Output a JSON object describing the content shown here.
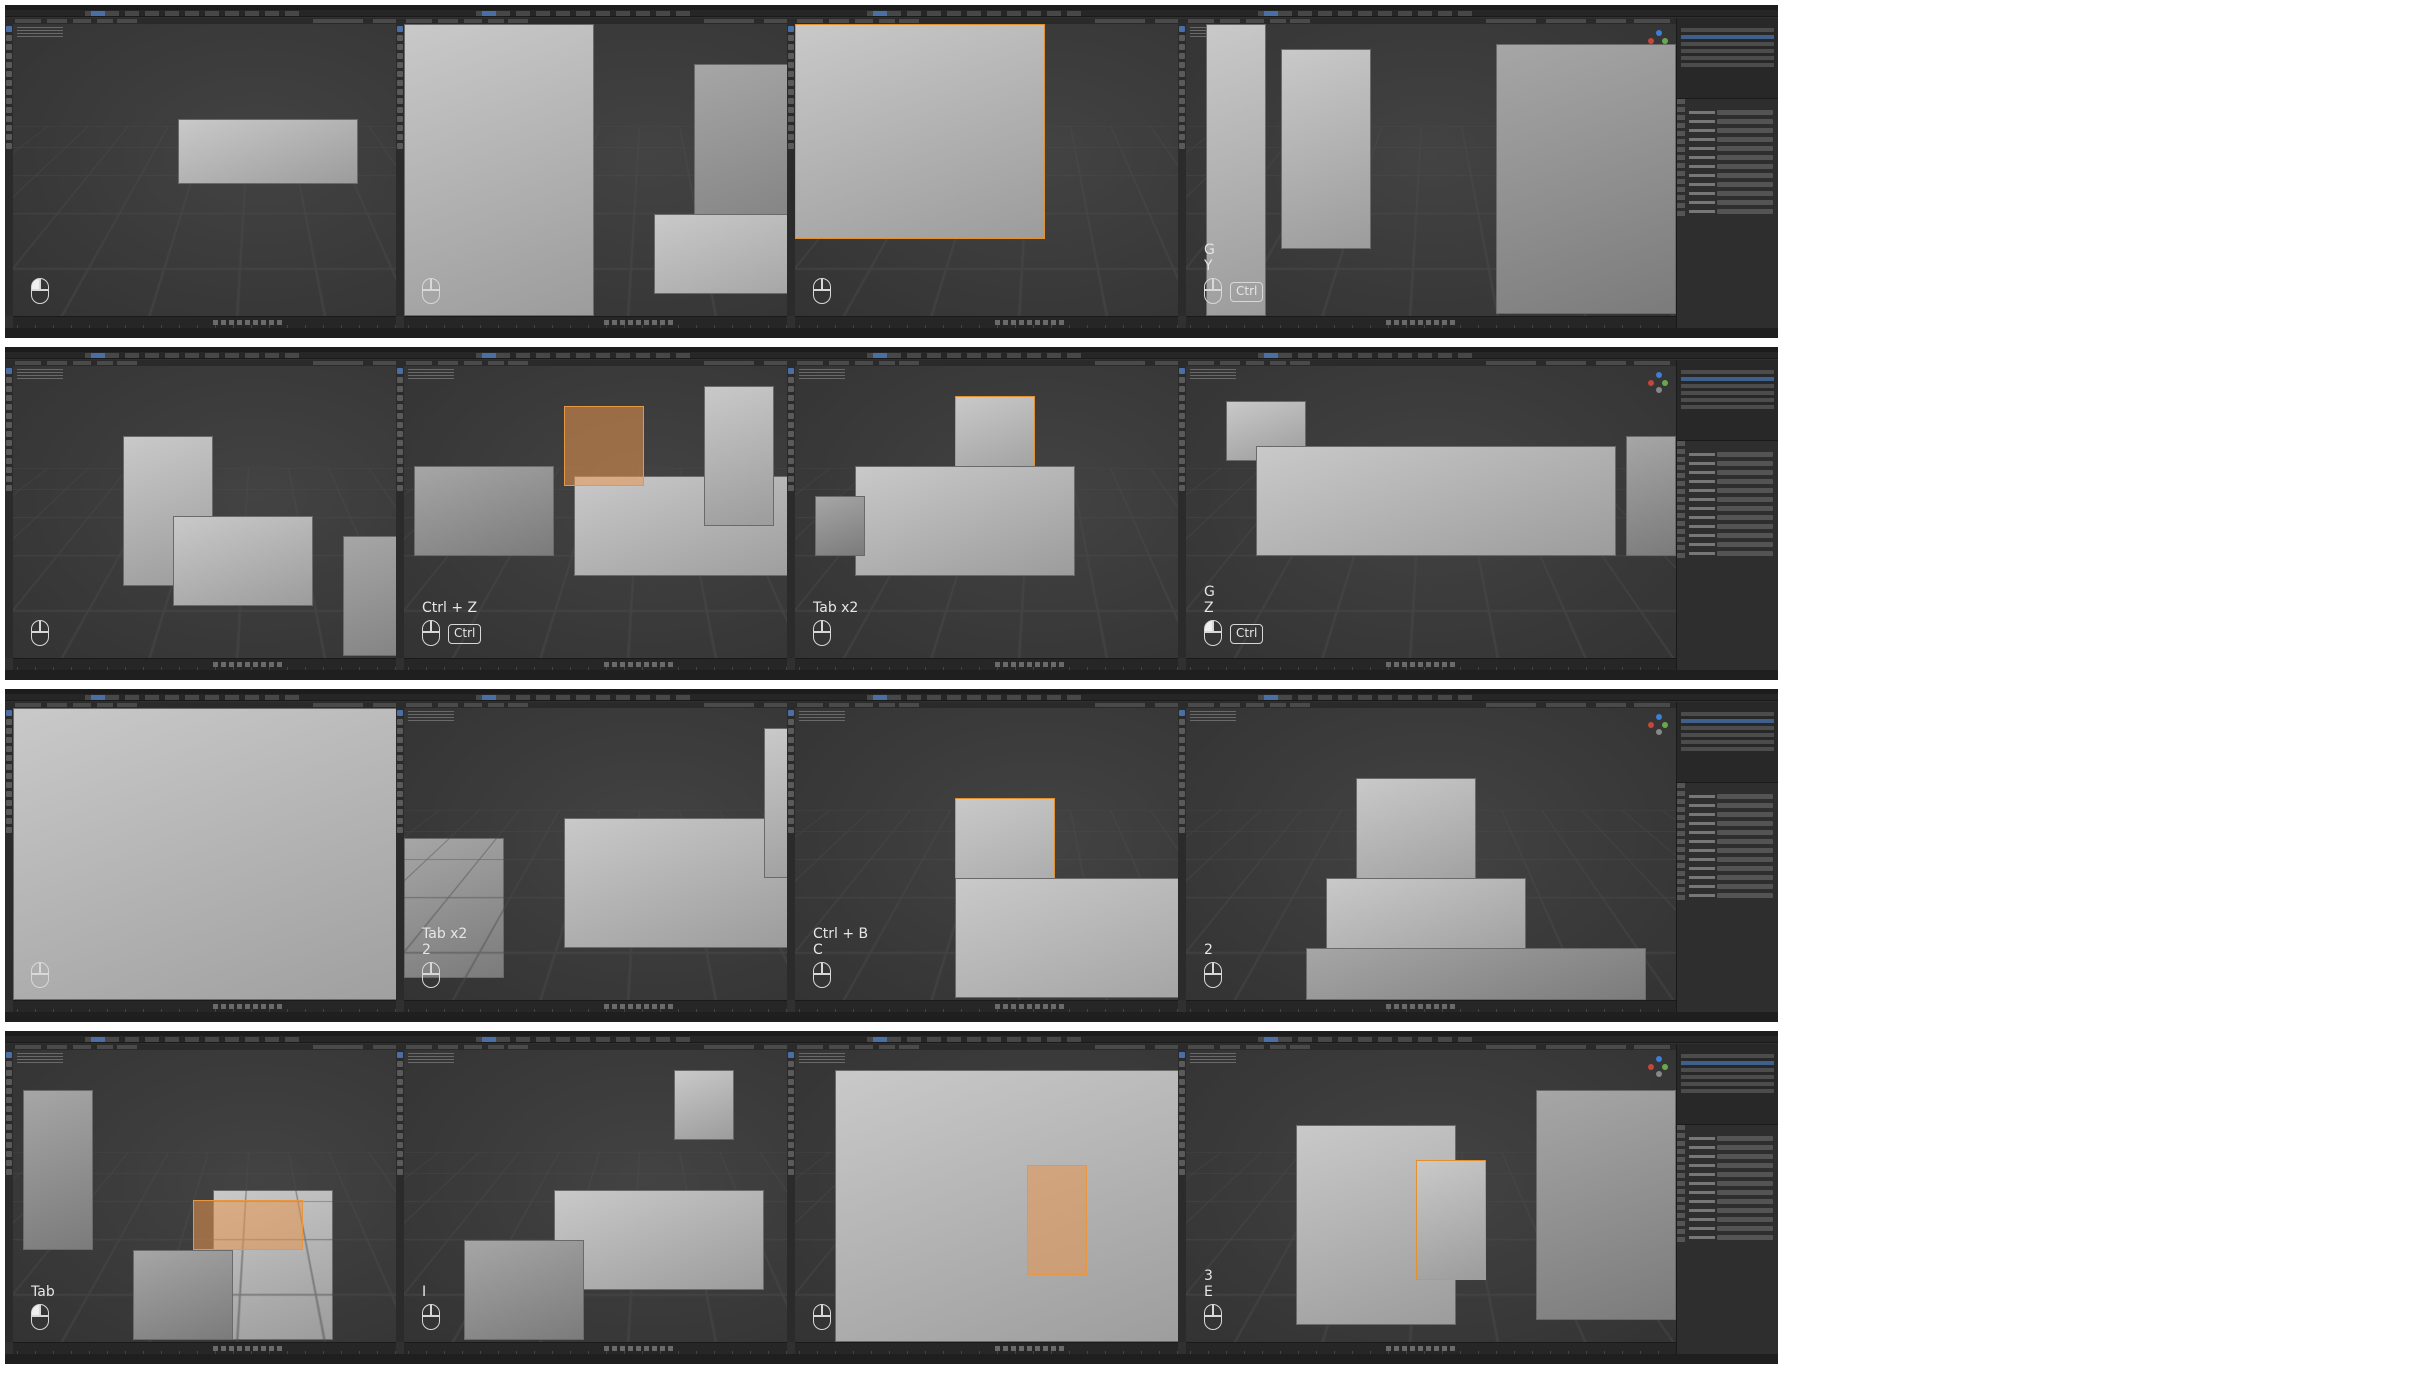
{
  "grid": {
    "columns": 4,
    "rows": 4,
    "frames": [
      {
        "id": 1,
        "keys": "",
        "mod": "",
        "lmb": true
      },
      {
        "id": 2,
        "keys": "",
        "mod": "",
        "lmb": false
      },
      {
        "id": 3,
        "keys": "",
        "mod": "",
        "lmb": false
      },
      {
        "id": 4,
        "keys": "G\nY",
        "mod": "Ctrl",
        "lmb": false
      },
      {
        "id": 5,
        "keys": "",
        "mod": "",
        "lmb": false
      },
      {
        "id": 6,
        "keys": "Ctrl + Z",
        "mod": "Ctrl",
        "lmb": false
      },
      {
        "id": 7,
        "keys": "Tab x2",
        "mod": "",
        "lmb": false
      },
      {
        "id": 8,
        "keys": "G\nZ",
        "mod": "Ctrl",
        "lmb": true
      },
      {
        "id": 9,
        "keys": "",
        "mod": "",
        "lmb": false
      },
      {
        "id": 10,
        "keys": "Tab x2\n2",
        "mod": "",
        "lmb": false
      },
      {
        "id": 11,
        "keys": "Ctrl + B\nC",
        "mod": "",
        "lmb": false
      },
      {
        "id": 12,
        "keys": "2",
        "mod": "",
        "lmb": false
      },
      {
        "id": 13,
        "keys": "Tab",
        "mod": "",
        "lmb": true
      },
      {
        "id": 14,
        "keys": "I",
        "mod": "",
        "lmb": false
      },
      {
        "id": 15,
        "keys": "",
        "mod": "",
        "lmb": false
      },
      {
        "id": 16,
        "keys": "3\nE",
        "mod": "",
        "lmb": false
      }
    ]
  },
  "colors": {
    "viewport_bg": "#3a3a3a",
    "mesh": "#b4b4b4",
    "selection_outline": "#e5902e",
    "selected_face": "#e8963f",
    "active_tab": "#4a6fa5",
    "axis_x": "#c8453a",
    "axis_y": "#6aa84f",
    "axis_z": "#3d7fd6"
  },
  "icons": [
    "mouse-icon",
    "navigation-gizmo-icon",
    "tool-icon"
  ]
}
